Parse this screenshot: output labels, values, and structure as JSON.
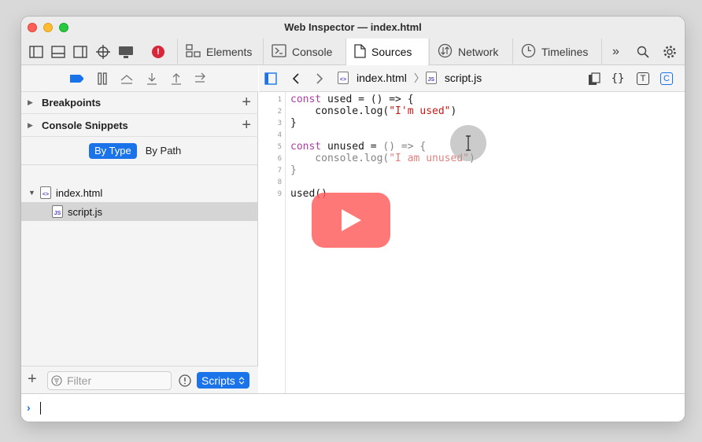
{
  "window": {
    "title": "Web Inspector — index.html"
  },
  "tabs": [
    {
      "label": "Elements",
      "icon": "elements-icon"
    },
    {
      "label": "Console",
      "icon": "console-icon"
    },
    {
      "label": "Sources",
      "icon": "sources-icon",
      "active": true
    },
    {
      "label": "Network",
      "icon": "network-icon"
    },
    {
      "label": "Timelines",
      "icon": "timelines-icon"
    }
  ],
  "toolbar": {
    "overflow": "»",
    "error_badge": "!"
  },
  "sidebar": {
    "sections": [
      {
        "label": "Breakpoints"
      },
      {
        "label": "Console Snippets"
      }
    ],
    "group_by": {
      "by_type": "By Type",
      "by_path": "By Path",
      "selected": "By Type"
    },
    "tree": [
      {
        "label": "index.html",
        "type": "html"
      },
      {
        "label": "script.js",
        "type": "js",
        "selected": true
      }
    ],
    "filter": {
      "placeholder": "Filter"
    },
    "scope": {
      "label": "Scripts"
    }
  },
  "navbar": {
    "crumbs": [
      "index.html",
      "script.js"
    ],
    "html_badge": "<>",
    "js_badge": "JS",
    "brace_button": "{}",
    "type_button": "T",
    "coverage_button": "C"
  },
  "editor": {
    "line_numbers": [
      "1",
      "2",
      "3",
      "4",
      "5",
      "6",
      "7",
      "8",
      "9"
    ],
    "lines": [
      {
        "parts": [
          [
            "kw",
            "const"
          ],
          [
            "plain",
            " used = () => {"
          ]
        ]
      },
      {
        "parts": [
          [
            "plain",
            "    console.log("
          ],
          [
            "str",
            "\"I'm used\""
          ],
          [
            "plain",
            ")"
          ]
        ]
      },
      {
        "parts": [
          [
            "plain",
            "}"
          ]
        ]
      },
      {
        "parts": []
      },
      {
        "parts": [
          [
            "kw",
            "const"
          ],
          [
            "plain",
            " unused = "
          ],
          [
            "dim",
            "() => {"
          ]
        ]
      },
      {
        "parts": [
          [
            "dim",
            "    console.log("
          ],
          [
            "dimstr",
            "\"I am unused\""
          ],
          [
            "dim",
            ")"
          ]
        ]
      },
      {
        "parts": [
          [
            "dim",
            "}"
          ]
        ]
      },
      {
        "parts": []
      },
      {
        "parts": [
          [
            "plain",
            "used()"
          ]
        ]
      }
    ]
  },
  "colors": {
    "accent": "#1a73e8",
    "error": "#d6283a",
    "keyword": "#ad3da4",
    "string": "#c41a16",
    "play": "#ff5a5a"
  }
}
